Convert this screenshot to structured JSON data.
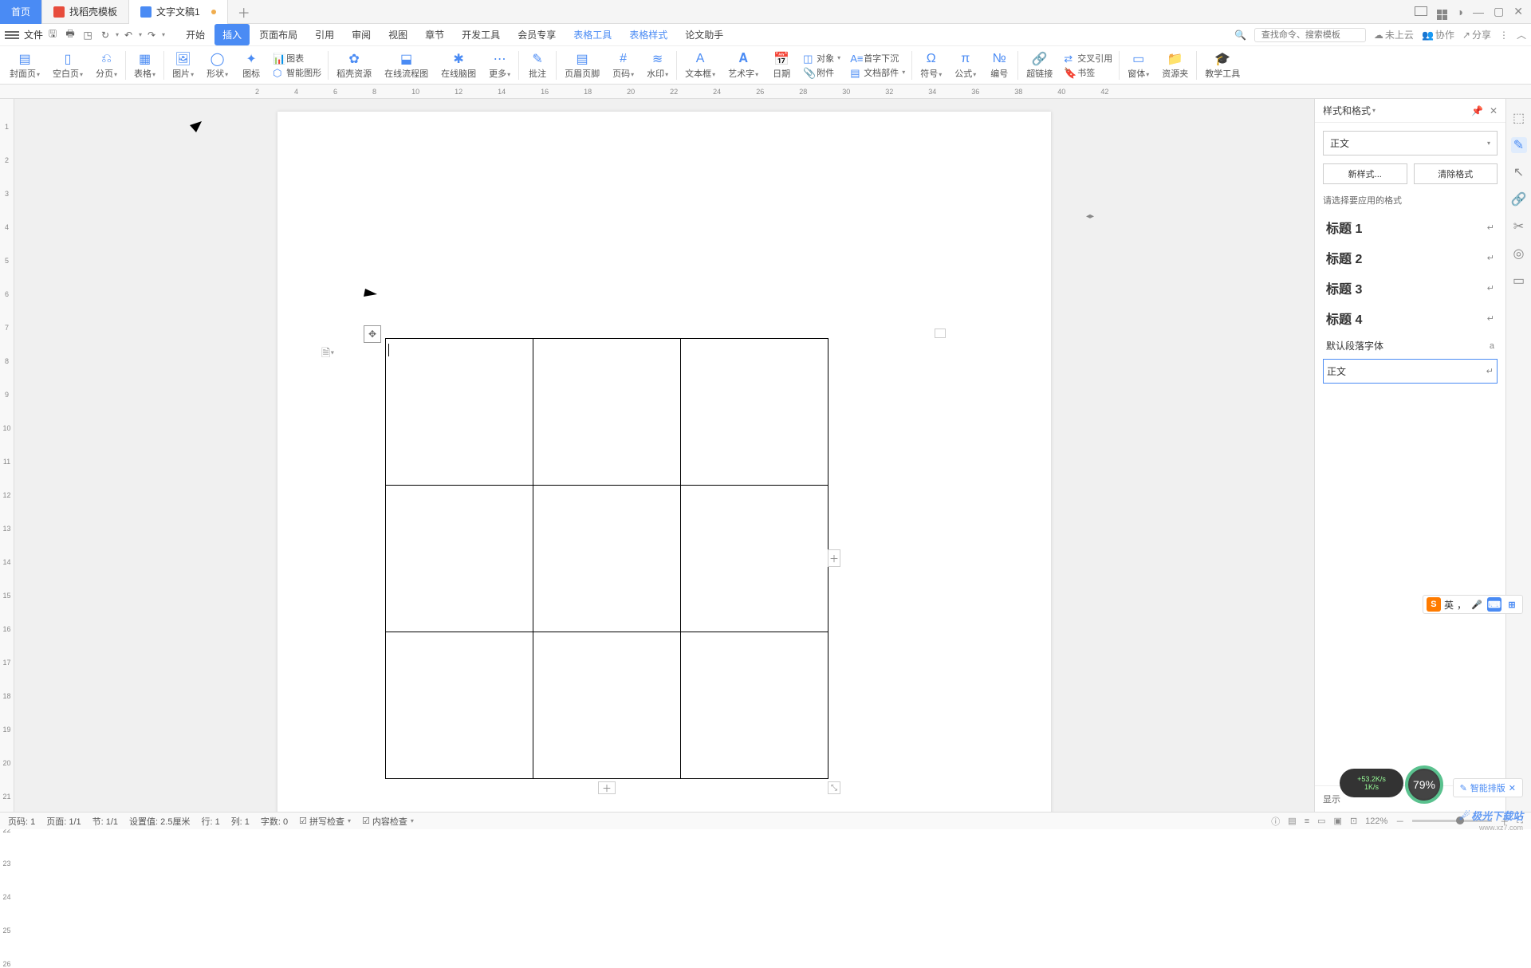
{
  "tabs": {
    "home": "首页",
    "template": "找稻壳模板",
    "doc": "文字文稿1"
  },
  "menu": {
    "file": "文件",
    "items": [
      "开始",
      "插入",
      "页面布局",
      "引用",
      "审阅",
      "视图",
      "章节",
      "开发工具",
      "会员专享",
      "表格工具",
      "表格样式",
      "论文助手"
    ],
    "search_ph": "查找命令、搜索模板",
    "cloud": "未上云",
    "coop": "协作",
    "share": "分享"
  },
  "ribbon": {
    "cover": "封面页",
    "blank": "空白页",
    "section": "分页",
    "table": "表格",
    "image": "图片",
    "shape": "形状",
    "icon": "图标",
    "chart": "图表",
    "smartart": "智能图形",
    "dockres": "稻壳资源",
    "flowchart": "在线流程图",
    "mindmap": "在线脑图",
    "more": "更多",
    "comment": "批注",
    "headerfooter": "页眉页脚",
    "pageno": "页码",
    "watermark": "水印",
    "textbox": "文本框",
    "wordart": "艺术字",
    "date": "日期",
    "object": "对象",
    "attach": "附件",
    "dropcap": "首字下沉",
    "docpart": "文档部件",
    "symbol": "符号",
    "formula": "公式",
    "number": "编号",
    "hyperlink": "超链接",
    "xref": "交叉引用",
    "bookmark": "书签",
    "font": "窗体",
    "resource": "资源夹",
    "teaching": "教学工具"
  },
  "panel": {
    "title": "样式和格式",
    "current": "正文",
    "new_style": "新样式...",
    "clear": "清除格式",
    "hint": "请选择要应用的格式",
    "styles": [
      "标题 1",
      "标题 2",
      "标题 3",
      "标题 4"
    ],
    "default_font": "默认段落字体",
    "body": "正文",
    "show": "显示"
  },
  "status": {
    "page": "页码: 1",
    "pages": "页面: 1/1",
    "section": "节: 1/1",
    "pos": "设置值: 2.5厘米",
    "line": "行: 1",
    "col": "列: 1",
    "words": "字数: 0",
    "spell": "拼写检查",
    "content": "内容检查",
    "zoom": "122%"
  },
  "widgets": {
    "ime": "英",
    "smart": "智能排版",
    "net_up": "+53.2K/s",
    "net_dn": "1K/s",
    "perf": "79%",
    "wm1": "极光下载站",
    "wm2": "www.xz7.com"
  }
}
